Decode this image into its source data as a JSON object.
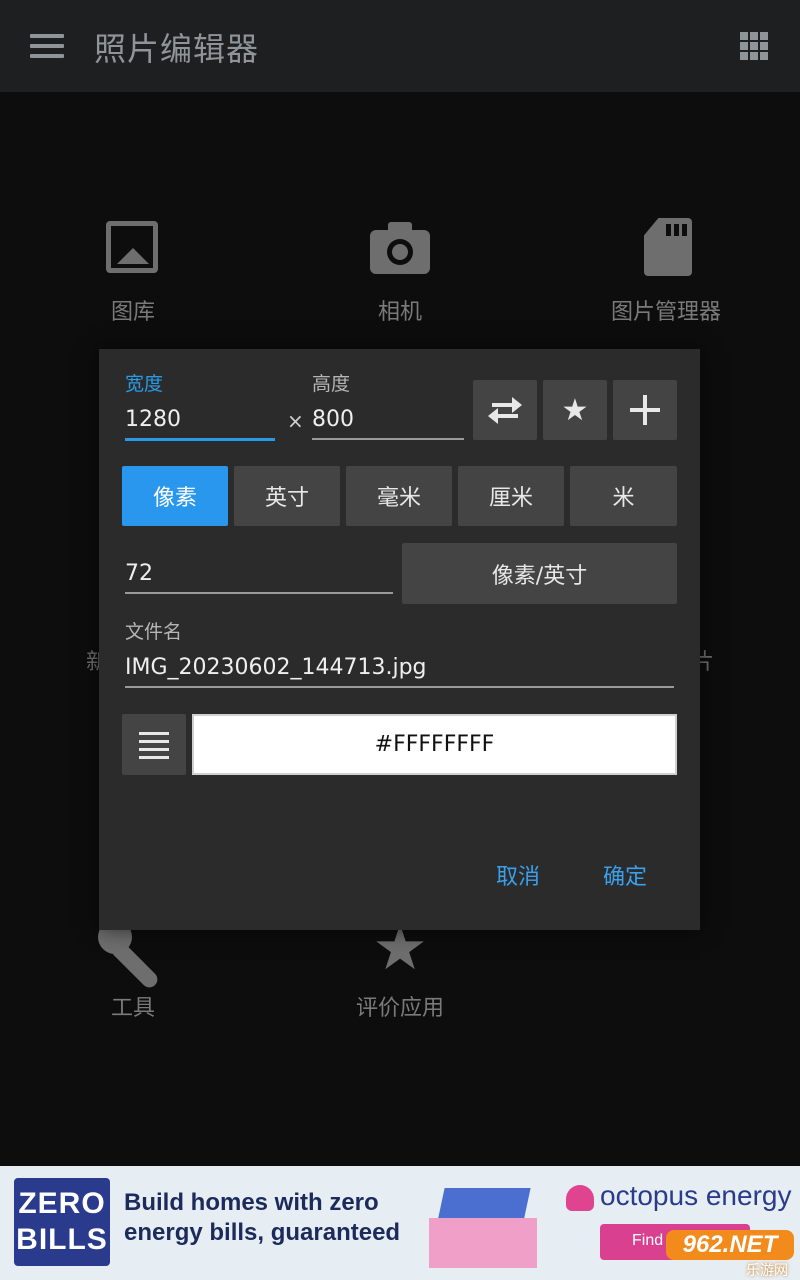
{
  "appbar": {
    "title": "照片编辑器",
    "menu_icon": "menu-icon",
    "grid_icon": "apps-grid-icon"
  },
  "home": {
    "tiles": [
      {
        "label": "图库",
        "icon": "gallery-icon"
      },
      {
        "label": "相机",
        "icon": "camera-icon"
      },
      {
        "label": "图片管理器",
        "icon": "sd-card-icon"
      },
      {
        "label": "工具",
        "icon": "wrench-icon"
      },
      {
        "label": "评价应用",
        "icon": "star-icon"
      }
    ],
    "partial_left": "新",
    "partial_right": "片"
  },
  "dialog": {
    "width_label": "宽度",
    "width_value": "1280",
    "times": "×",
    "height_label": "高度",
    "height_value": "800",
    "units": [
      "像素",
      "英寸",
      "毫米",
      "厘米",
      "米"
    ],
    "selected_unit": "像素",
    "resolution_value": "72",
    "resolution_unit": "像素/英寸",
    "filename_label": "文件名",
    "filename_value": "IMG_20230602_144713.jpg",
    "color_value": "#FFFFFFFF",
    "cancel": "取消",
    "ok": "确定",
    "accent_color": "#2a97ee"
  },
  "ad": {
    "logo_line1": "ZERO",
    "logo_line2": "BILLS",
    "headline_line1": "Build homes with zero",
    "headline_line2": "energy bills, guaranteed",
    "brand": "octopus energy",
    "cta": "Find",
    "watermark_main": "962.NET",
    "watermark_sub": "乐游网"
  }
}
